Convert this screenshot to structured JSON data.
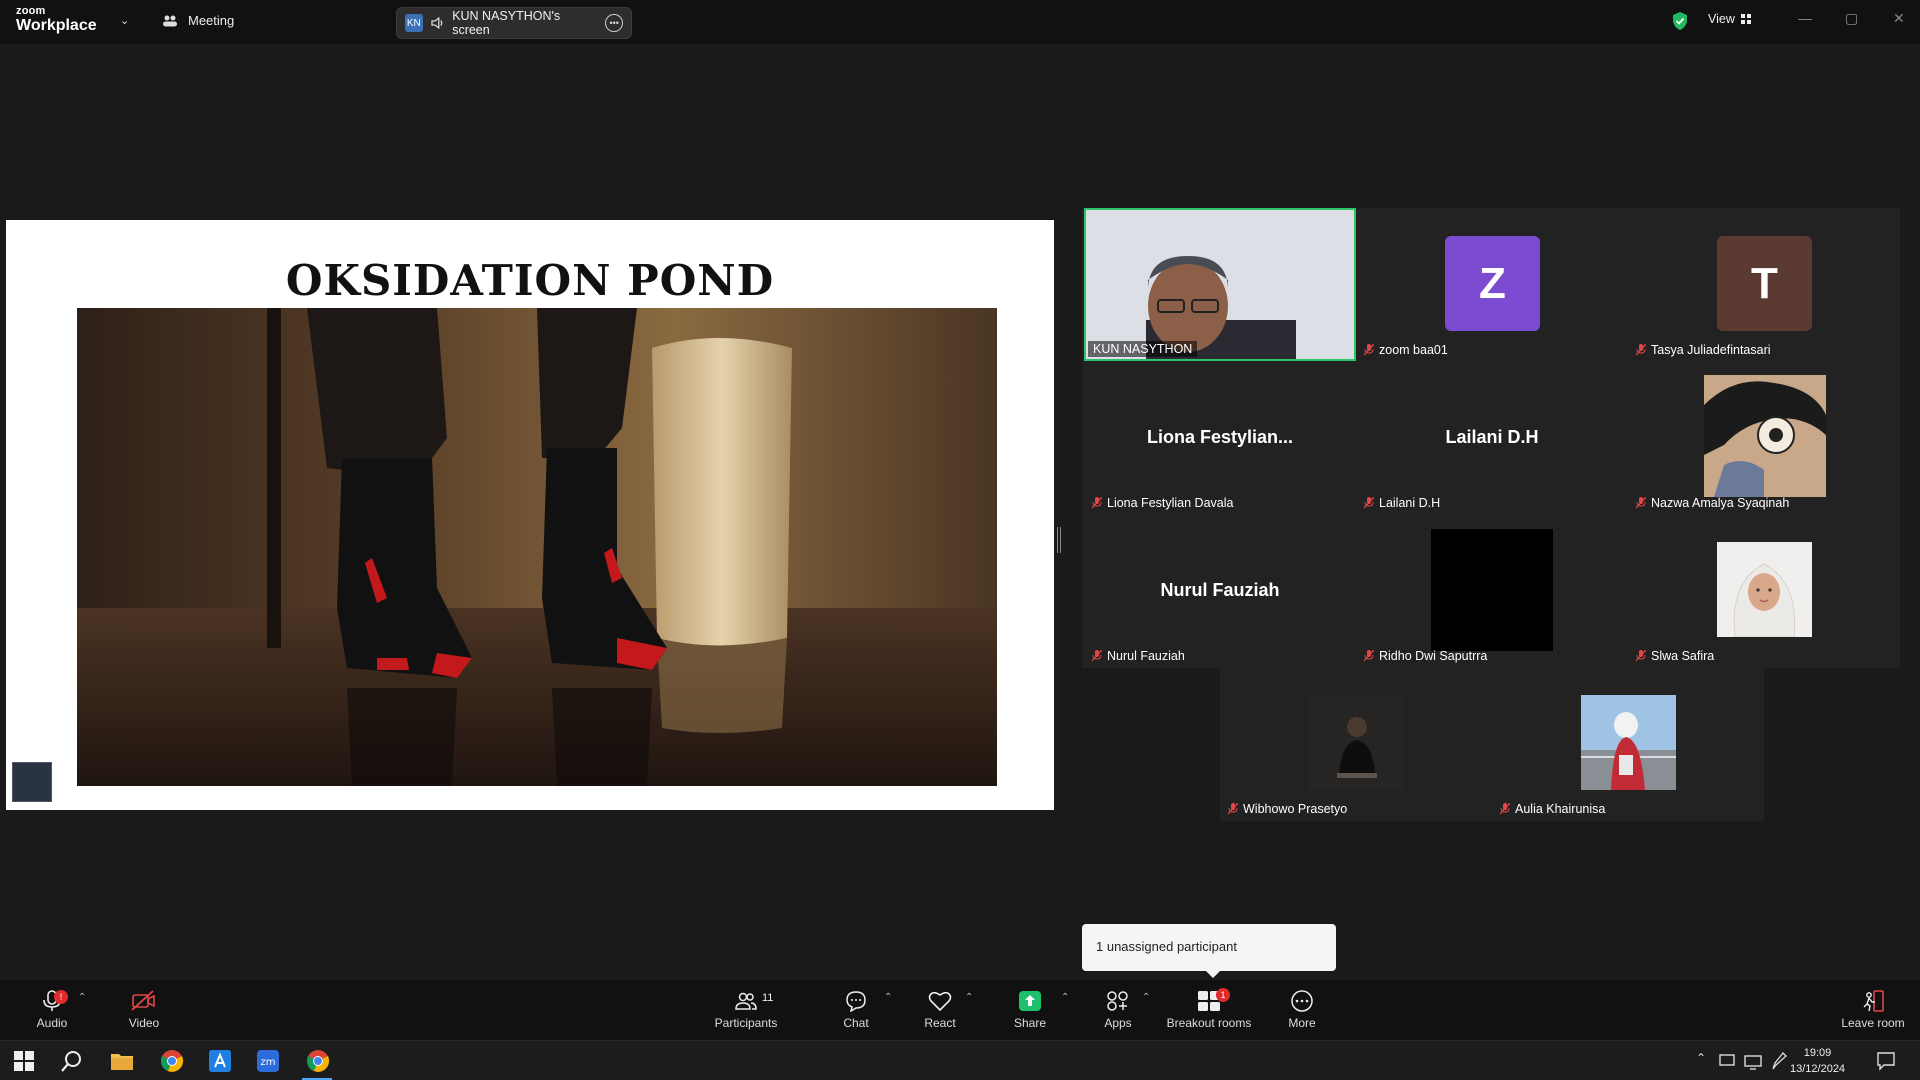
{
  "app": {
    "logo_small": "zoom",
    "logo_big": "Workplace",
    "meeting_label": "Meeting",
    "share_badge": "KN",
    "share_title": "KUN NASYTHON's screen",
    "view_label": "View"
  },
  "slide": {
    "title": "OKSIDATION POND"
  },
  "participants": [
    {
      "name": "KUN NASYTHON",
      "type": "video",
      "muted": false
    },
    {
      "name": "zoom baa01",
      "type": "letter",
      "letter": "Z",
      "color": "#7b4bd1",
      "muted": true
    },
    {
      "name": "Tasya Juliadefintasari",
      "type": "letter",
      "letter": "T",
      "color": "#5b3a32",
      "muted": true
    },
    {
      "name": "Liona Festylian Davala",
      "display": "Liona  Festylian...",
      "type": "text",
      "muted": true
    },
    {
      "name": "Lailani D.H",
      "display": "Lailani D.H",
      "type": "text",
      "muted": true
    },
    {
      "name": "Nazwa Amalya Syaqinah",
      "type": "image",
      "muted": true
    },
    {
      "name": "Nurul Fauziah",
      "display": "Nurul Fauziah",
      "type": "text",
      "muted": true
    },
    {
      "name": "Ridho Dwi Saputrra",
      "type": "black",
      "muted": true
    },
    {
      "name": "Slwa Safira",
      "type": "image",
      "muted": true
    },
    {
      "name": "Wibhowo Prasetyo",
      "type": "image",
      "muted": true
    },
    {
      "name": "Aulia Khairunisa",
      "type": "image",
      "muted": true
    }
  ],
  "breakout": {
    "unassigned_text": "1 unassigned participant"
  },
  "toolbar": {
    "audio": "Audio",
    "video": "Video",
    "participants": "Participants",
    "participants_count": "11",
    "chat": "Chat",
    "react": "React",
    "share": "Share",
    "apps": "Apps",
    "breakout": "Breakout rooms",
    "breakout_badge": "1",
    "audio_badge": "!",
    "more": "More",
    "leave": "Leave room"
  },
  "taskbar": {
    "time": "19:09",
    "date": "13/12/2024"
  }
}
